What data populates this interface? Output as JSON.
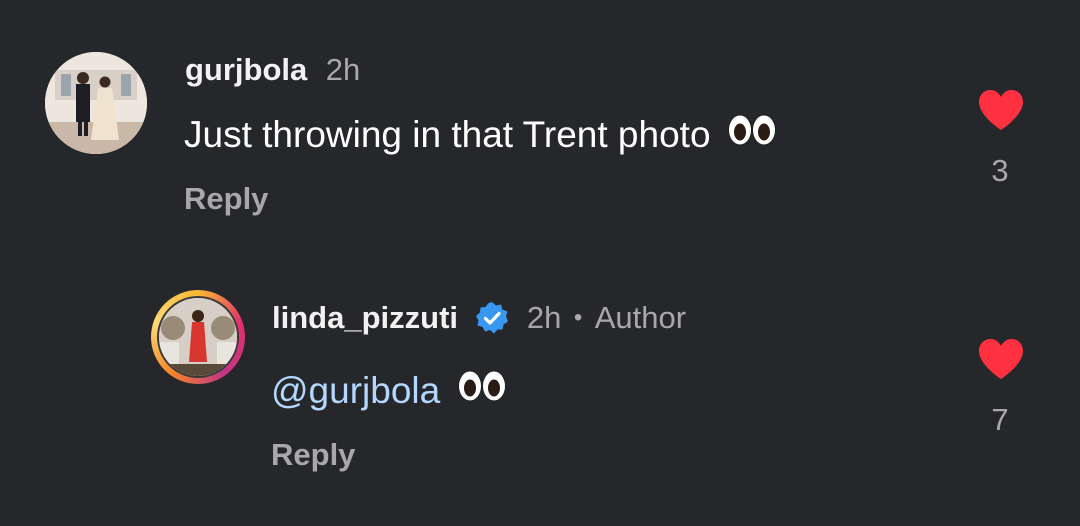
{
  "comments": [
    {
      "username": "gurjbola",
      "time": "2h",
      "text": "Just throwing in that Trent photo",
      "emoji": "eyes",
      "reply_label": "Reply",
      "likes": "3"
    },
    {
      "username": "linda_pizzuti",
      "verified": true,
      "time": "2h",
      "separator": "•",
      "author_badge": "Author",
      "mention": "@gurjbola",
      "emoji": "eyes",
      "reply_label": "Reply",
      "likes": "7"
    }
  ],
  "colors": {
    "background": "#25272b",
    "heart": "#ff3040",
    "mention": "#b3d7ff",
    "verified": "#3897f0"
  }
}
